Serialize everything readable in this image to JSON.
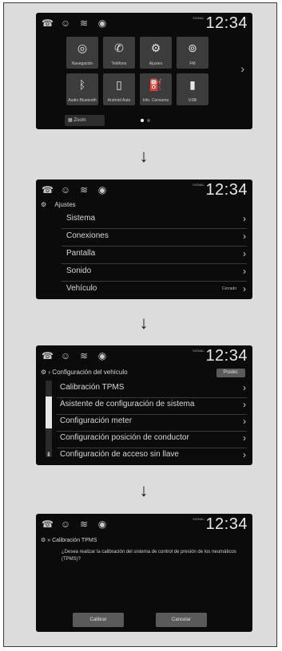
{
  "status_bar": {
    "icons": [
      "hands-free-phone-icon",
      "person-icon",
      "signal-icon",
      "speaker-icon"
    ],
    "signal_label": "SIGNAL",
    "clock": "12:34"
  },
  "screen1": {
    "tiles": [
      {
        "label": "Navegación",
        "icon": "navigation-icon"
      },
      {
        "label": "Teléfono",
        "icon": "phone-icon"
      },
      {
        "label": "Ajustes",
        "icon": "settings-icon"
      },
      {
        "label": "FM",
        "icon": "radio-icon"
      },
      {
        "label": "Audio Bluetooth",
        "icon": "bluetooth-icon"
      },
      {
        "label": "Android Auto",
        "icon": "phone-device-icon"
      },
      {
        "label": "Info. Consumo",
        "icon": "fuel-icon"
      },
      {
        "label": "USB",
        "icon": "usb-icon"
      }
    ],
    "bottom_button": "Zoom"
  },
  "screen2": {
    "title": "Ajustes",
    "items": [
      {
        "label": "Sistema",
        "value": ""
      },
      {
        "label": "Conexiones",
        "value": ""
      },
      {
        "label": "Pantalla",
        "value": ""
      },
      {
        "label": "Sonido",
        "value": ""
      },
      {
        "label": "Vehículo",
        "value": "Cerrado"
      }
    ]
  },
  "screen3": {
    "title": "Configuración del vehículo",
    "button": "Predet.",
    "items": [
      {
        "label": "Calibración TPMS"
      },
      {
        "label": "Asistente de configuración de sistema"
      },
      {
        "label": "Configuración meter"
      },
      {
        "label": "Configuración posición de conductor"
      },
      {
        "label": "Configuración de acceso sin llave"
      }
    ]
  },
  "screen4": {
    "title": "Calibración TPMS",
    "message": "¿Desea realizar la calibración del sistema de control de presión de los neumáticos (TPMS)?",
    "buttons": [
      "Calibrar",
      "Cancelar"
    ]
  }
}
